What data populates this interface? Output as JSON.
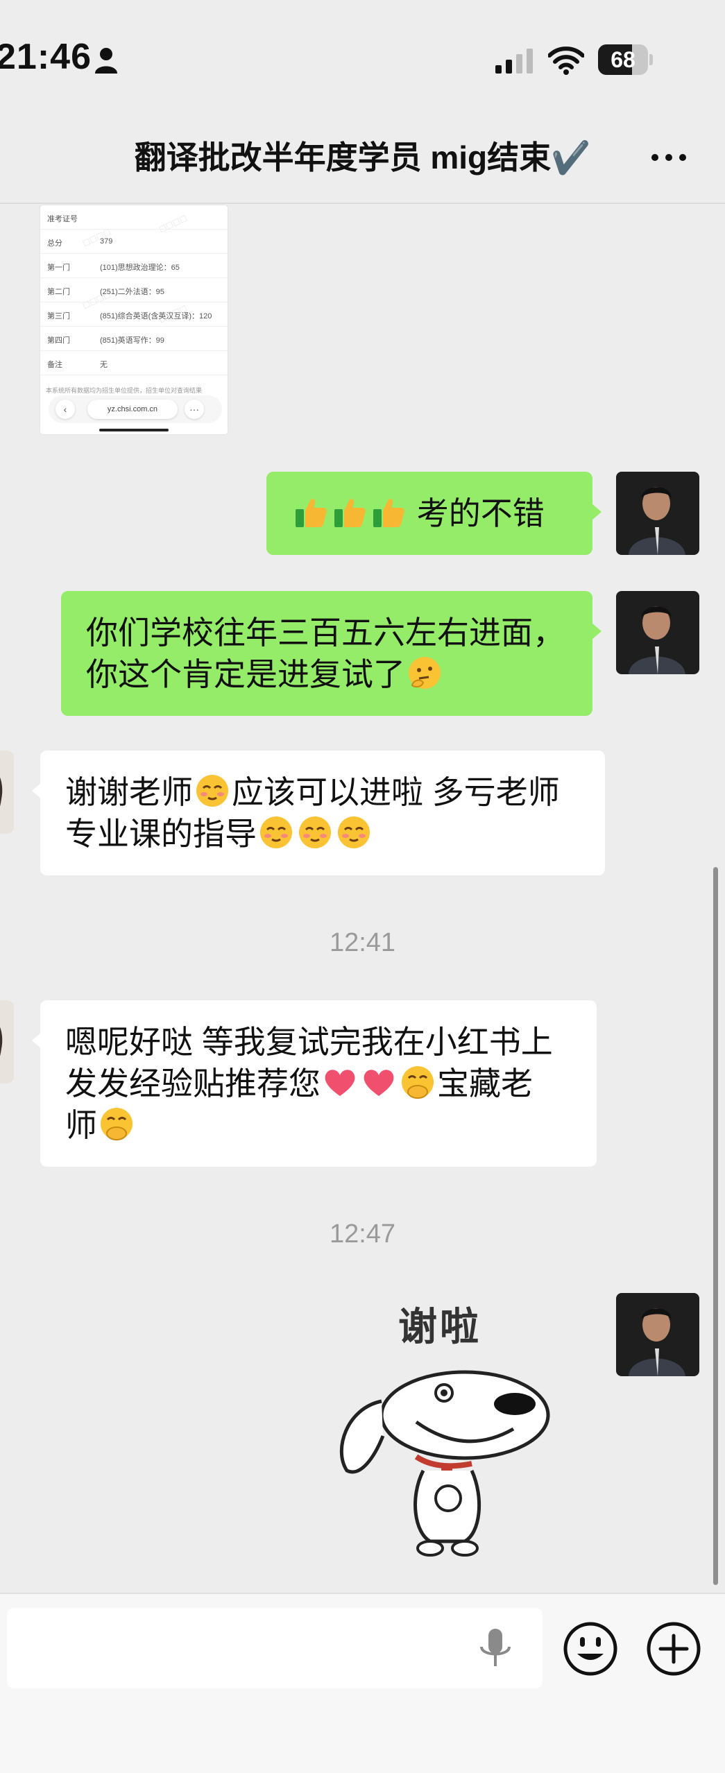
{
  "status": {
    "time": "21:46",
    "battery": "68",
    "battery_level": 0.68
  },
  "header": {
    "title": "翻译批改半年度学员 mig结束✔️"
  },
  "score_screenshot": {
    "rows": [
      {
        "k": "准考证号",
        "v": ""
      },
      {
        "k": "总分",
        "v": "379"
      },
      {
        "k": "第一门",
        "v": "(101)思想政治理论：65"
      },
      {
        "k": "第二门",
        "v": "(251)二外法语：95"
      },
      {
        "k": "第三门",
        "v": "(851)综合英语(含英汉互译)：120"
      },
      {
        "k": "第四门",
        "v": "(851)英语写作：99"
      },
      {
        "k": "备注",
        "v": "无"
      }
    ],
    "note": "本系统所有数据均为招生单位提供，招生单位对查询结果",
    "url": "yz.chsi.com.cn"
  },
  "messages": {
    "m1": {
      "text": "考的不错"
    },
    "m2": {
      "line1": "你们学校往年三百五六左右进面，",
      "line2": "你这个肯定是进复试了"
    },
    "m3": {
      "line1a": "谢谢老师",
      "line1b": "应该可以进啦 多亏老师",
      "line2": "专业课的指导"
    },
    "m4": {
      "line1": "嗯呢好哒 等我复试完我在小红书上",
      "line2a": "发发经验贴推荐您",
      "line2b": "宝藏老",
      "line3": "师"
    },
    "sticker_text": "谢啦"
  },
  "timestamps": {
    "t1": "12:41",
    "t2": "12:47"
  },
  "input": {
    "value": "",
    "placeholder": ""
  }
}
